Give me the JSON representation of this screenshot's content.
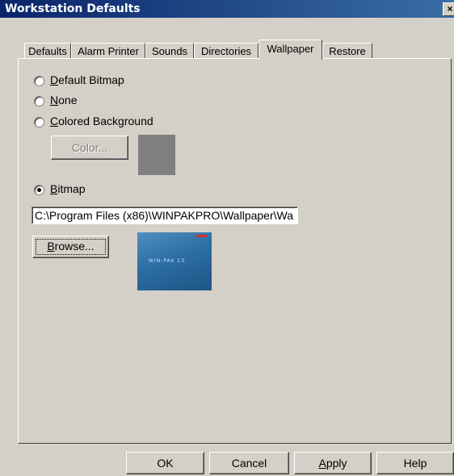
{
  "window": {
    "title": "Workstation Defaults",
    "close_symbol": "×"
  },
  "tabs": [
    {
      "label": "Defaults",
      "active": false
    },
    {
      "label": "Alarm Printer",
      "active": false
    },
    {
      "label": "Sounds",
      "active": false
    },
    {
      "label": "Directories",
      "active": false
    },
    {
      "label": "Wallpaper",
      "active": true
    },
    {
      "label": "Restore",
      "active": false
    }
  ],
  "wallpaper": {
    "options": [
      {
        "mnemonic": "D",
        "rest": "efault Bitmap",
        "checked": false
      },
      {
        "mnemonic": "N",
        "rest": "one",
        "checked": false
      },
      {
        "mnemonic": "C",
        "rest": "olored Background",
        "checked": false
      },
      {
        "mnemonic": "B",
        "rest": "itmap",
        "checked": true
      }
    ],
    "color_button": "Color...",
    "swatch_color": "#7f7f7f",
    "path_value": "C:\\Program Files (x86)\\WINPAKPRO\\Wallpaper\\Wa",
    "browse_mnemonic": "B",
    "browse_rest": "rowse..."
  },
  "footer": {
    "ok": "OK",
    "cancel": "Cancel",
    "apply_mnemonic": "A",
    "apply_rest": "pply",
    "help": "Help"
  }
}
